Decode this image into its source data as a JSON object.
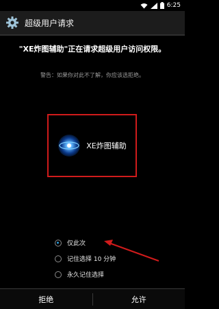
{
  "status_bar": {
    "time": "6:25",
    "icons": [
      "wifi-icon",
      "signal-icon",
      "battery-icon"
    ]
  },
  "title_bar": {
    "icon": "gear-icon",
    "title": "超级用户请求"
  },
  "dialog": {
    "heading": "\"XE炸图辅助\"正在请求超级用户访问权限。",
    "warning": "警告：如果你对此不了解，你应该选拒绝。",
    "app": {
      "icon": "app-logo-icon",
      "name": "XE炸图辅助"
    },
    "options": [
      {
        "label": "仅此次",
        "selected": true
      },
      {
        "label": "记住选择 10 分钟",
        "selected": false
      },
      {
        "label": "永久记住选择",
        "selected": false
      }
    ],
    "deny_label": "拒绝",
    "allow_label": "允许"
  },
  "colors": {
    "highlight_border": "#d01b1b",
    "annotation_arrow": "#d01b1b",
    "radio_selected": "#2a9bd8"
  }
}
